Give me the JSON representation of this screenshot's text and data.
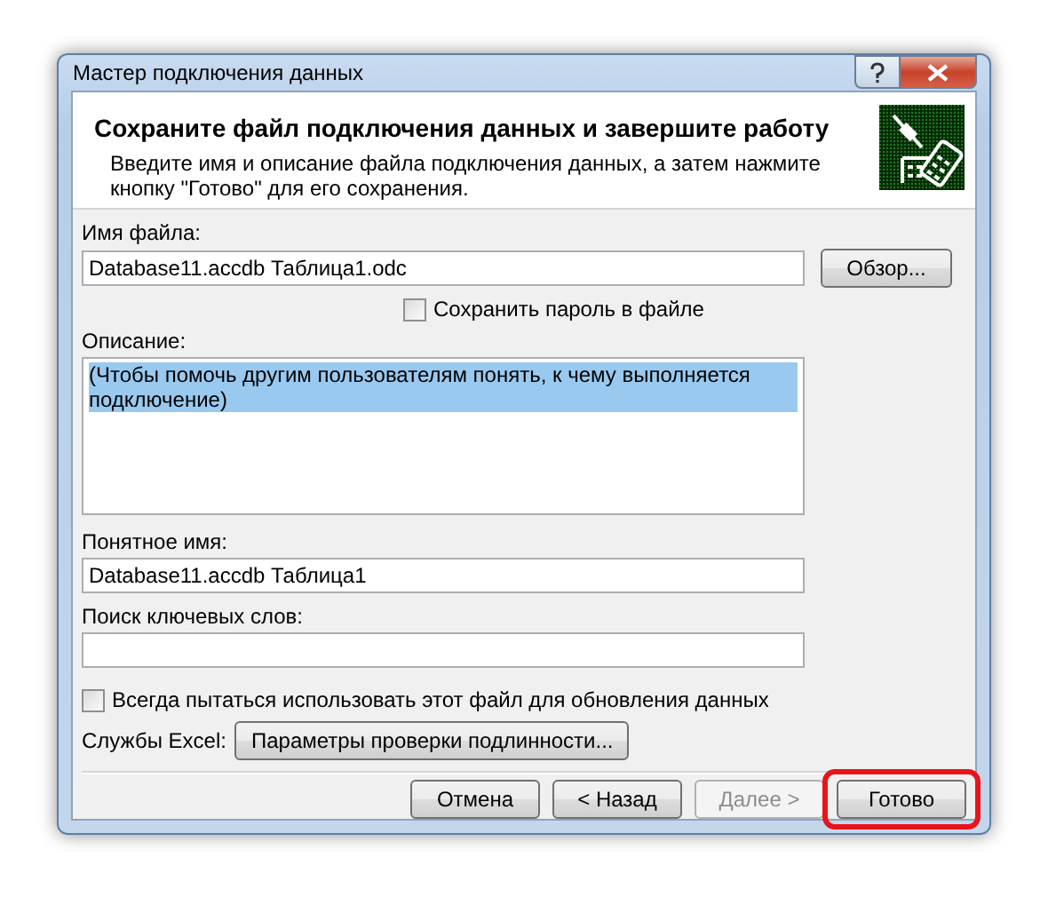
{
  "window": {
    "title": "Мастер подключения данных"
  },
  "header": {
    "title": "Сохраните файл подключения данных и завершите работу",
    "description": "Введите имя и описание файла подключения данных, а затем нажмите кнопку \"Готово\" для его сохранения."
  },
  "file_name": {
    "label": "Имя файла:",
    "value": "Database11.accdb Таблица1.odc",
    "button": "Обзор..."
  },
  "save_password": {
    "label": "Сохранить пароль в файле",
    "checked": false
  },
  "description": {
    "label": "Описание:",
    "value": "(Чтобы помочь другим пользователям понять, к чему выполняется подключение)",
    "selected": true
  },
  "friendly_name": {
    "label": "Понятное имя:",
    "value": "Database11.accdb Таблица1"
  },
  "keywords": {
    "label": "Поиск ключевых слов:"
  },
  "always_use": {
    "label": "Всегда пытаться использовать этот файл для обновления данных",
    "checked": false
  },
  "excel_services": {
    "label": "Службы Excel:",
    "button": "Параметры проверки подлинности..."
  },
  "buttons": [
    {
      "label": "Отмена",
      "disabled": false,
      "highlighted": false
    },
    {
      "label": "< Назад",
      "disabled": false,
      "highlighted": false
    },
    {
      "label": "Далее >",
      "disabled": true,
      "highlighted": false
    },
    {
      "label": "Готово",
      "disabled": false,
      "highlighted": true
    }
  ]
}
